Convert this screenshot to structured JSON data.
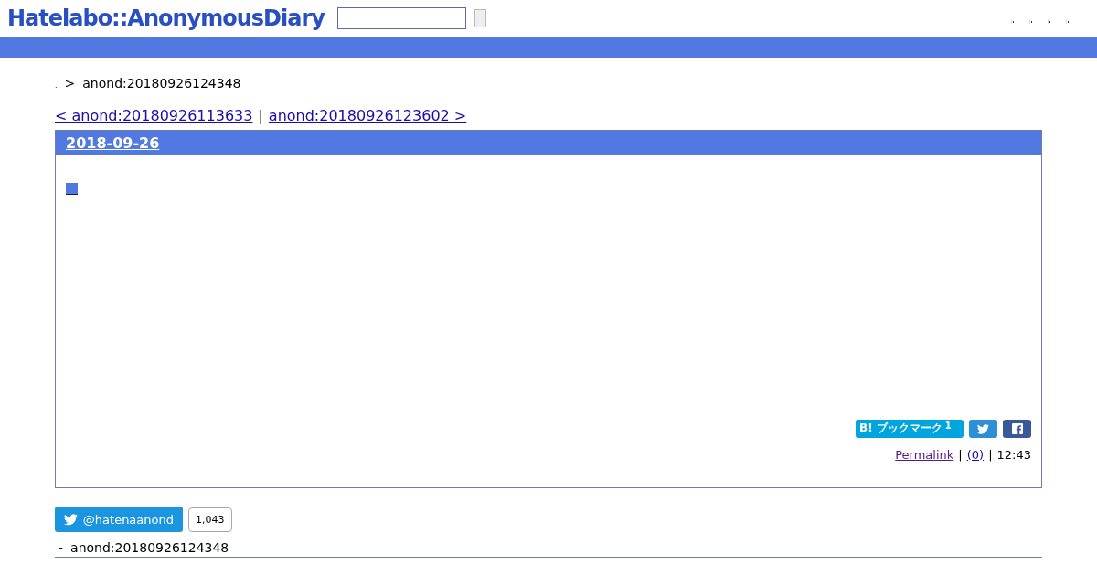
{
  "header": {
    "logo": "Hatelabo::AnonymousDiary",
    "icons": [
      {
        "kind": "broken-image"
      },
      {
        "kind": "broken-image"
      },
      {
        "kind": "broken-image"
      },
      {
        "kind": "broken-image"
      }
    ]
  },
  "breadcrumb": {
    "home": ".",
    "separator": ">",
    "current": "anond:20180926124348"
  },
  "pager": {
    "prev": "< anond:20180926113633",
    "divider": "|",
    "next": "anond:20180926123602 >"
  },
  "day": {
    "date": "2018-09-26",
    "share": {
      "bookmark_label": "B! ブックマーク",
      "bookmark_count": "1"
    },
    "footer": {
      "permalink": "Permalink",
      "sep1": "|",
      "comments": "(0)",
      "sep2": "|",
      "time": "12:43"
    }
  },
  "follow": {
    "handle": "@hatenaanond",
    "count": "1,043"
  },
  "bottom": {
    "dash": "-",
    "title": "anond:20180926124348"
  }
}
